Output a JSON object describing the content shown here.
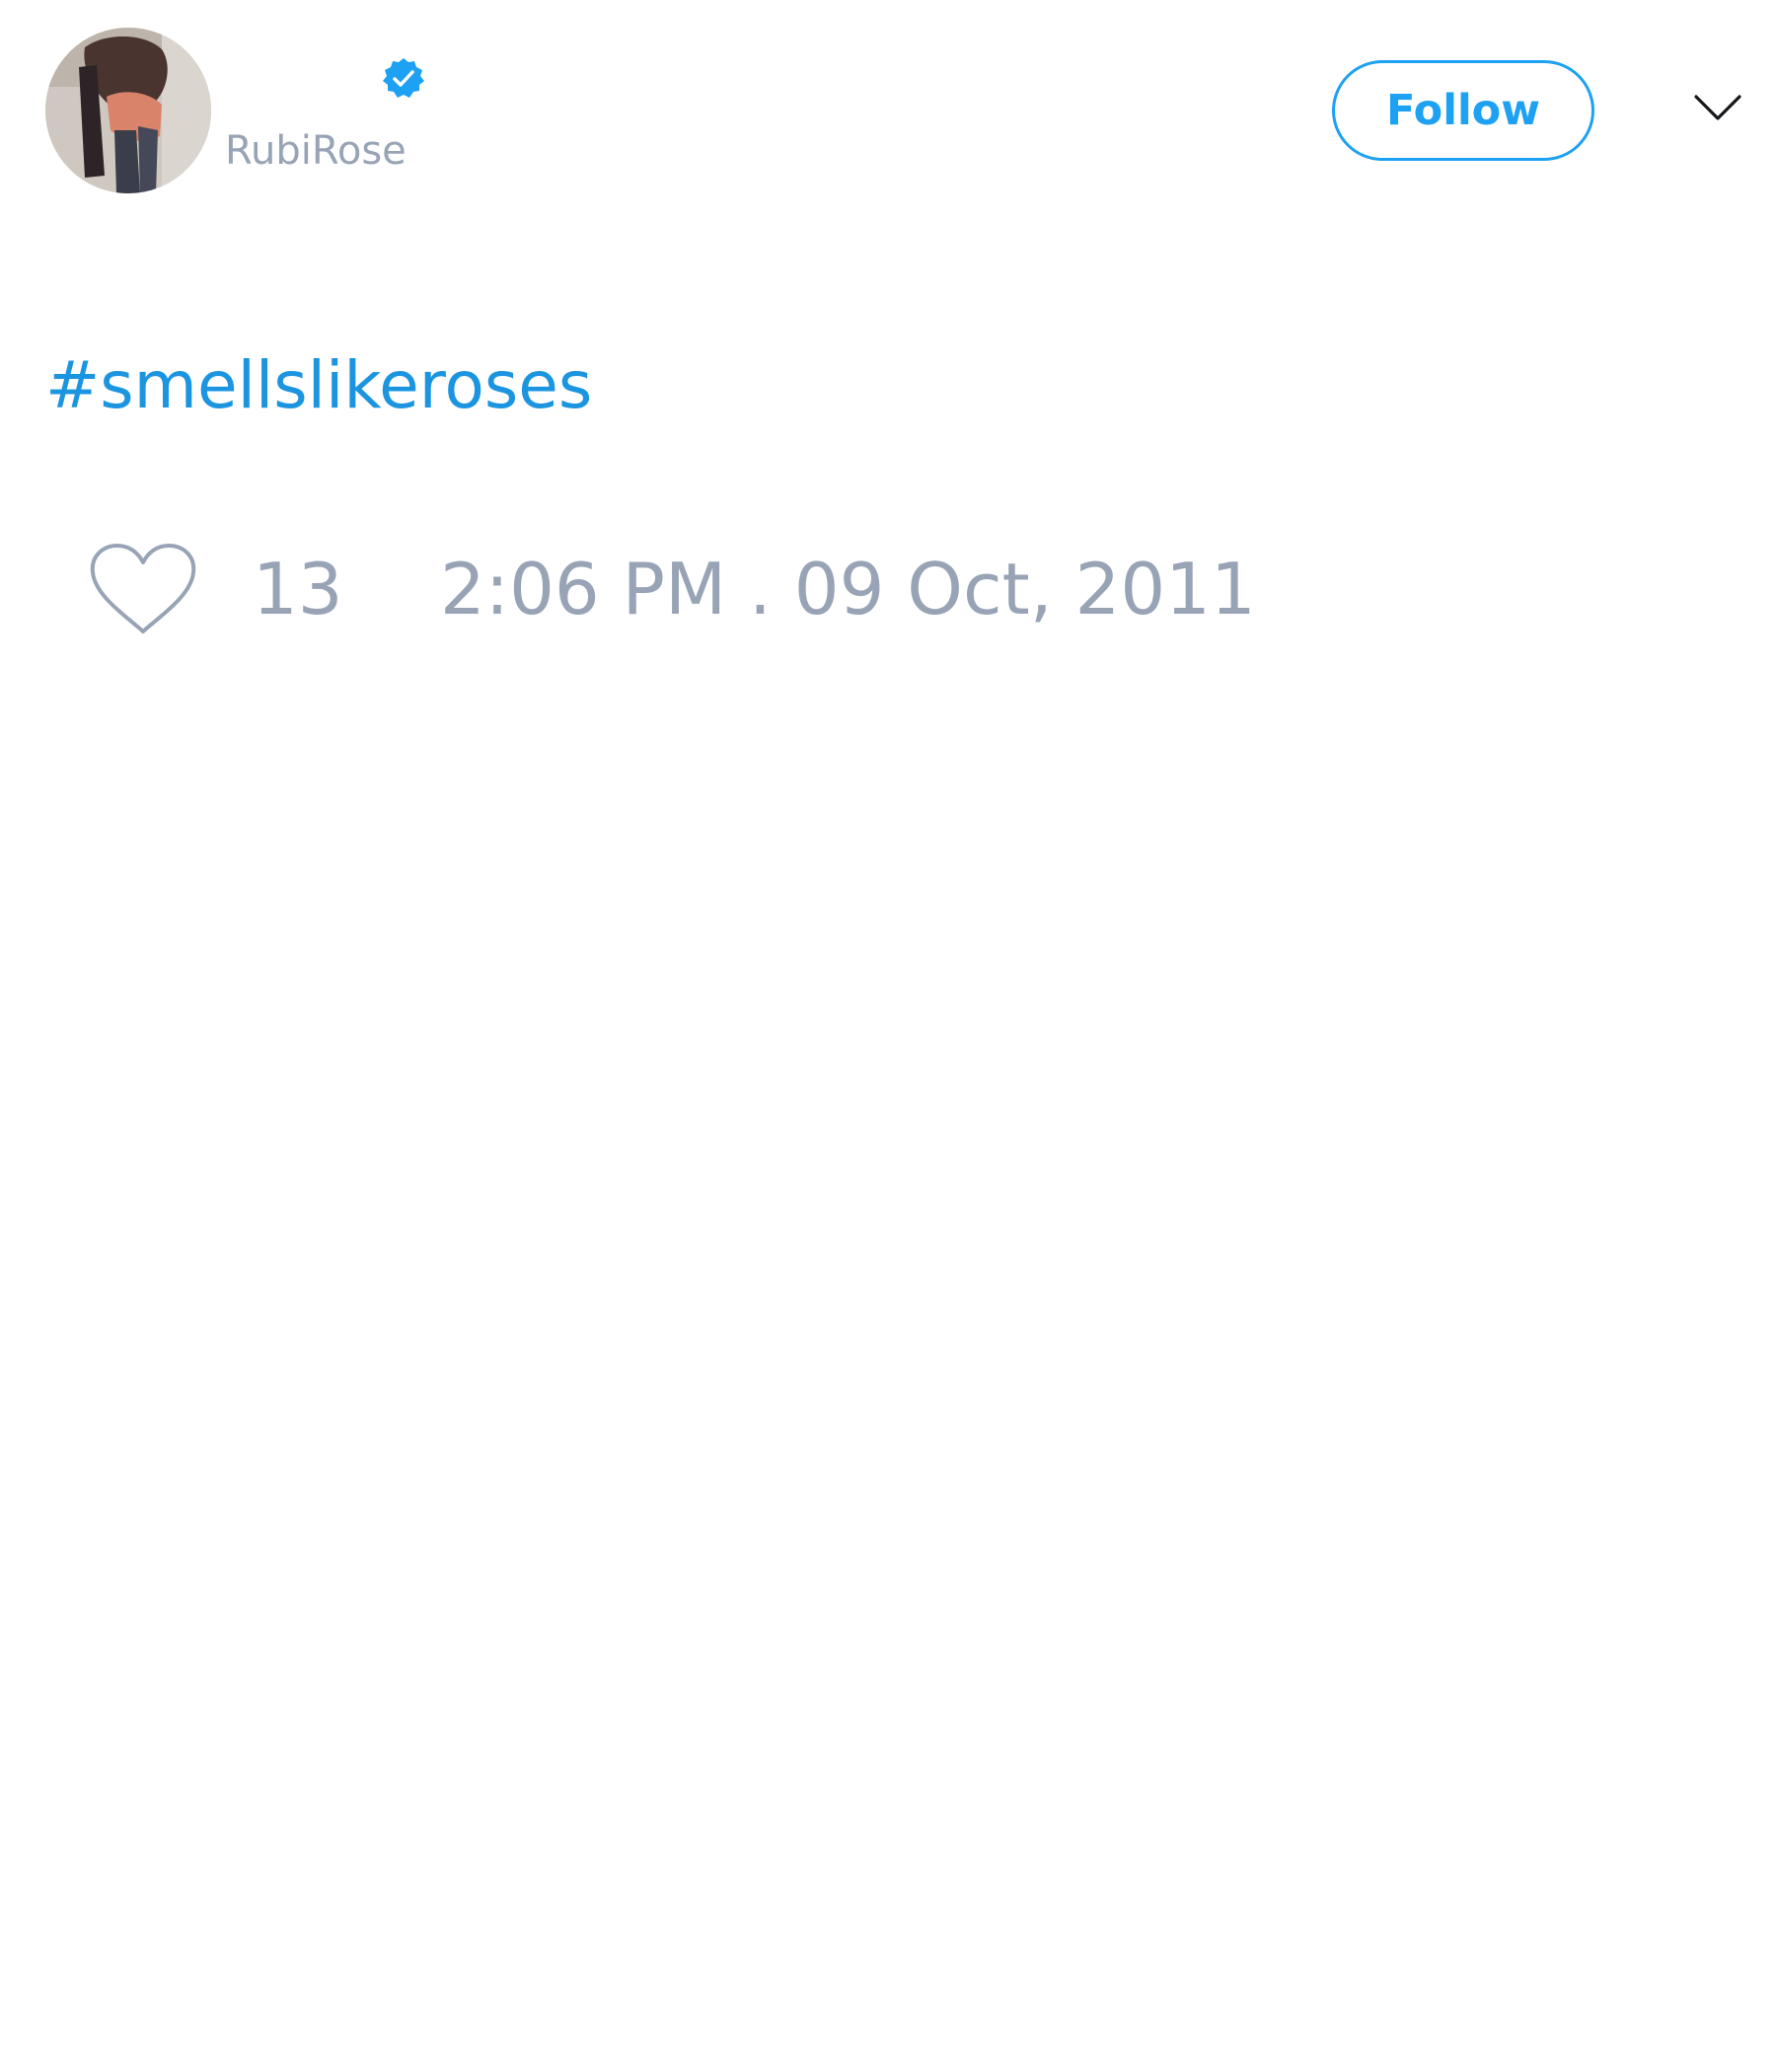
{
  "author": {
    "handle": "RubiRose",
    "verified": true,
    "avatar_description": "profile photo"
  },
  "header": {
    "follow_label": "Follow",
    "menu_icon": "chevron-down-icon"
  },
  "tweet": {
    "text": "#smellslikeroses"
  },
  "footer": {
    "like_icon": "heart-icon",
    "like_count": "13",
    "timestamp": "2:06 PM . 09 Oct, 2011"
  },
  "colors": {
    "accent": "#1da1f2",
    "hashtag": "#1b95e0",
    "muted_text": "#98a4b6",
    "background": "#ffffff"
  }
}
